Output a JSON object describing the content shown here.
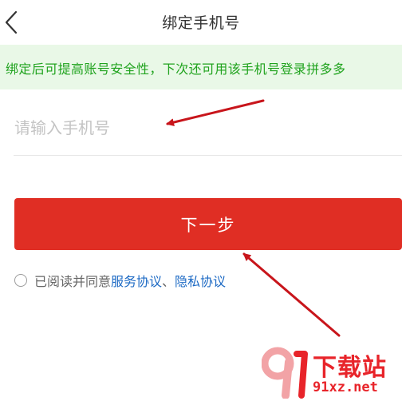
{
  "header": {
    "title": "绑定手机号",
    "back_icon": "chevron-left-icon"
  },
  "notice": {
    "text": "绑定后可提高账号安全性，下次还可用该手机号登录拼多多"
  },
  "phone_input": {
    "value": "",
    "placeholder": "请输入手机号"
  },
  "next_button": {
    "label": "下一步"
  },
  "agreement": {
    "checked": false,
    "prefix": "已阅读并同意",
    "service_link": "服务协议",
    "separator": "、",
    "privacy_link": "隐私协议"
  },
  "watermark": {
    "name": "下载站",
    "site": "91xz.net"
  },
  "colors": {
    "primary_red": "#e02e24",
    "notice_bg": "#e9f8e7",
    "notice_text": "#20a31e",
    "link_blue": "#1d6ac4",
    "annotation_red": "#c8151b"
  }
}
